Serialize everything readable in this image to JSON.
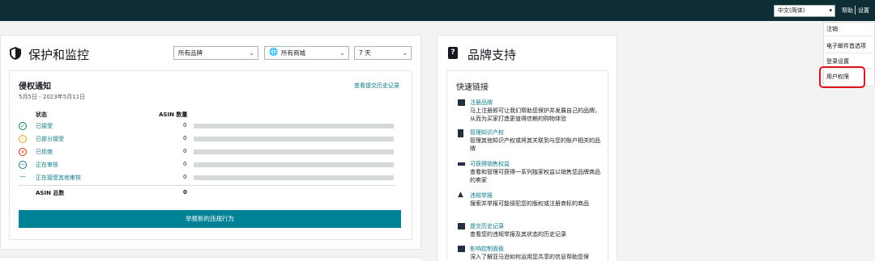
{
  "topbar": {
    "language": "中文(简体)",
    "help": "帮助",
    "settings": "设置"
  },
  "dropdown": {
    "items": [
      "注销",
      "电子邮件首选项",
      "登录设置",
      "用户权限"
    ]
  },
  "protect": {
    "title": "保护和监控",
    "filters": {
      "brand": "所有品牌",
      "marketplace": "所有商城",
      "range": "7 天"
    },
    "notice": {
      "title": "侵权通知",
      "date_range": "5月5日 - 2023年5月11日",
      "history_link": "查看提交历史记录",
      "col_status": "状态",
      "col_asin": "ASIN 数量",
      "rows": [
        {
          "label": "已接受",
          "count": "0",
          "color": "#067d62"
        },
        {
          "label": "已部分接受",
          "count": "0",
          "color": "#e3a008"
        },
        {
          "label": "已拒绝",
          "count": "0",
          "color": "#d13212"
        },
        {
          "label": "正在审核",
          "count": "0",
          "color": "#0f7a8c"
        },
        {
          "label": "正在接受其他审核",
          "count": "0",
          "color": "#0f7a8c"
        }
      ],
      "total_label": "ASIN 总数",
      "total_count": "0"
    },
    "cta": "举报新的违规行为"
  },
  "support": {
    "title": "品牌支持",
    "quick_links_title": "快速链接",
    "links": [
      {
        "title": "注册品牌",
        "desc": "马上注册即可让我们帮助您保护并发展自己的品牌，从而为买家打造更值得信赖的购物体验"
      },
      {
        "title": "管理知识产权",
        "desc": "管理其他知识产权或将其关联到与您的账户相关的品牌"
      },
      {
        "title": "可获得销售权益",
        "desc": "查看和管理可获得一系列独家权益以销售您品牌商品的卖家"
      },
      {
        "title": "违规举报",
        "desc": "搜索并举报可能侵犯您的版权或注册商标的商品"
      },
      {
        "title": "提交历史记录",
        "desc": "查看您的违规举报及其状态的历史记录"
      },
      {
        "title": "影响控制面板",
        "desc": "深入了解亚马逊如何运用您共享的信息帮助您保"
      }
    ]
  }
}
